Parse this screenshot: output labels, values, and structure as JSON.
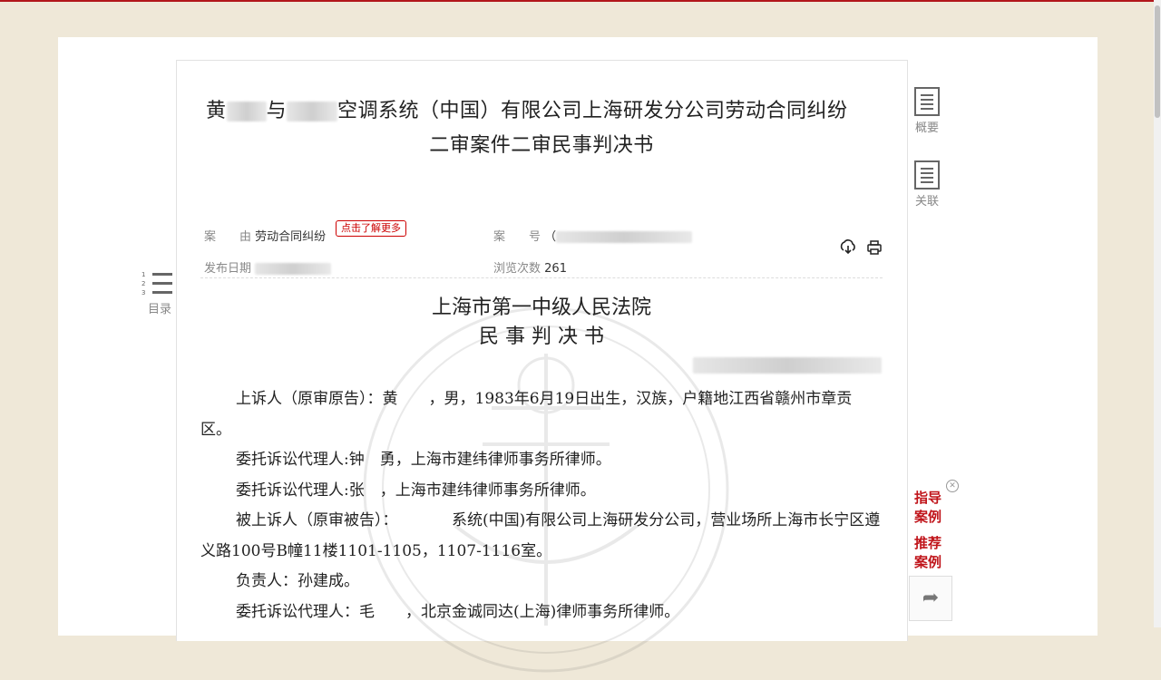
{
  "document": {
    "title_part1": "黄",
    "title_part2": "与",
    "title_part3": "空调系统（中国）有限公司上海研发分公司劳动合同纠纷",
    "title_line2": "二审案件二审民事判决书"
  },
  "meta": {
    "cause_label": "案　　由",
    "cause_value": "劳动合同纠纷",
    "cause_tag": "点击了解更多",
    "case_no_label": "案　　号",
    "case_no_value": "（",
    "publish_label": "发布日期",
    "views_label": "浏览次数",
    "views_value": "261"
  },
  "court": {
    "name": "上海市第一中级人民法院",
    "doc_type": "民 事 判 决 书"
  },
  "body": [
    "上诉人（原审原告）：黄　　，男，1983年6月19日出生，汉族，户籍地江西省赣州市章贡区。",
    "委托诉讼代理人:钟　勇，上海市建纬律师事务所律师。",
    "委托诉讼代理人:张　，上海市建纬律师事务所律师。",
    "被上诉人（原审被告）：　　　　系统(中国)有限公司上海研发分公司，营业场所上海市长宁区遵义路100号B幢11楼1101-1105，1107-1116室。",
    "负责人：孙建成。",
    "委托诉讼代理人：毛　　，北京金诚同达(上海)律师事务所律师。"
  ],
  "sidebar": {
    "toc_label": "目录",
    "summary_label": "概要",
    "related_label": "关联"
  },
  "ads": {
    "guide_line1": "指导",
    "guide_line2": "案例",
    "recommend_line1": "推荐",
    "recommend_line2": "案例"
  },
  "icons": {
    "download": "download-icon",
    "print": "print-icon",
    "toc": "list-numbered-icon",
    "summary": "document-icon",
    "related": "document-icon",
    "share": "share-icon",
    "close": "close-icon"
  },
  "colors": {
    "accent": "#c0141a",
    "background": "#efe8d8"
  }
}
